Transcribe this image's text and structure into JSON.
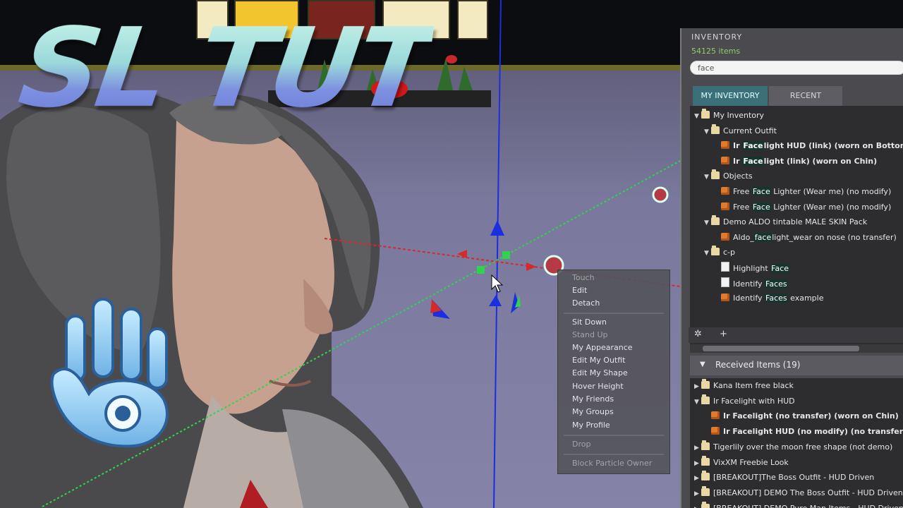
{
  "overlay": {
    "title": "SL TUT"
  },
  "context_menu": {
    "items": [
      {
        "label": "Touch",
        "dim": true
      },
      {
        "label": "Edit",
        "dim": false
      },
      {
        "label": "Detach",
        "dim": false
      },
      {
        "label": "Sit Down",
        "dim": false
      },
      {
        "label": "Stand Up",
        "dim": true
      },
      {
        "label": "My Appearance",
        "dim": false
      },
      {
        "label": "Edit My Outfit",
        "dim": false
      },
      {
        "label": "Edit My Shape",
        "dim": false
      },
      {
        "label": "Hover Height",
        "dim": false
      },
      {
        "label": "My Friends",
        "dim": false
      },
      {
        "label": "My Groups",
        "dim": false
      },
      {
        "label": "My Profile",
        "dim": false
      },
      {
        "label": "Drop",
        "dim": true
      },
      {
        "label": "Block Particle Owner",
        "dim": true
      }
    ]
  },
  "inventory": {
    "title": "INVENTORY",
    "count": "54125 items",
    "filter_value": "face",
    "tabs": [
      "MY INVENTORY",
      "RECENT"
    ],
    "active_tab": "MY INVENTORY",
    "tree": [
      {
        "indent": 0,
        "expanded": true,
        "icon": "folder",
        "parts": [
          {
            "t": "My Inventory"
          }
        ]
      },
      {
        "indent": 1,
        "expanded": true,
        "icon": "folder",
        "parts": [
          {
            "t": "Current Outfit"
          }
        ]
      },
      {
        "indent": 2,
        "icon": "object",
        "bold": true,
        "parts": [
          {
            "t": "Ir "
          },
          {
            "t": "Face",
            "hl": true
          },
          {
            "t": "light HUD (link) (worn on Bottom)"
          }
        ]
      },
      {
        "indent": 2,
        "icon": "object",
        "bold": true,
        "parts": [
          {
            "t": "Ir "
          },
          {
            "t": "Face",
            "hl": true
          },
          {
            "t": "light (link) (worn on Chin)"
          }
        ]
      },
      {
        "indent": 1,
        "expanded": true,
        "icon": "folder",
        "parts": [
          {
            "t": "Objects"
          }
        ]
      },
      {
        "indent": 2,
        "icon": "object",
        "parts": [
          {
            "t": "Free "
          },
          {
            "t": "Face",
            "hl": true
          },
          {
            "t": " Lighter (Wear me) (no modify)"
          }
        ]
      },
      {
        "indent": 2,
        "icon": "object",
        "parts": [
          {
            "t": "Free "
          },
          {
            "t": "Face",
            "hl": true
          },
          {
            "t": " Lighter (Wear me) (no modify)"
          }
        ]
      },
      {
        "indent": 1,
        "expanded": true,
        "icon": "folder",
        "parts": [
          {
            "t": "Demo ALDO tintable MALE SKIN Pack"
          }
        ]
      },
      {
        "indent": 2,
        "icon": "object",
        "parts": [
          {
            "t": "Aldo_"
          },
          {
            "t": "face",
            "hl": true
          },
          {
            "t": "light_wear on nose (no transfer)"
          }
        ]
      },
      {
        "indent": 1,
        "expanded": true,
        "icon": "folder",
        "parts": [
          {
            "t": "c-p"
          }
        ]
      },
      {
        "indent": 2,
        "icon": "note",
        "parts": [
          {
            "t": "Highlight "
          },
          {
            "t": "Face",
            "hl": true
          }
        ]
      },
      {
        "indent": 2,
        "icon": "note",
        "parts": [
          {
            "t": "Identify "
          },
          {
            "t": "Faces",
            "hl": true
          }
        ]
      },
      {
        "indent": 2,
        "icon": "object",
        "parts": [
          {
            "t": "Identify "
          },
          {
            "t": "Faces",
            "hl": true
          },
          {
            "t": " example"
          }
        ]
      }
    ],
    "received": {
      "title": "Received Items (19)",
      "items": [
        {
          "indent": 0,
          "expanded": false,
          "icon": "folder",
          "parts": [
            {
              "t": "Kana Item free black"
            }
          ]
        },
        {
          "indent": 0,
          "expanded": true,
          "icon": "folder",
          "parts": [
            {
              "t": "Ir Facelight with HUD"
            }
          ]
        },
        {
          "indent": 1,
          "icon": "object",
          "bold": true,
          "parts": [
            {
              "t": "Ir Facelight (no transfer) (worn on Chin)"
            }
          ]
        },
        {
          "indent": 1,
          "icon": "object",
          "bold": true,
          "parts": [
            {
              "t": "Ir Facelight HUD (no modify) (no transfer)"
            }
          ]
        },
        {
          "indent": 0,
          "expanded": false,
          "icon": "folder",
          "parts": [
            {
              "t": "Tigerlily over the moon free shape (not demo)"
            }
          ]
        },
        {
          "indent": 0,
          "expanded": false,
          "icon": "folder",
          "parts": [
            {
              "t": "VixXM Freebie Look"
            }
          ]
        },
        {
          "indent": 0,
          "expanded": false,
          "icon": "folder",
          "parts": [
            {
              "t": "[BREAKOUT]The Boss Outfit - HUD Driven"
            }
          ]
        },
        {
          "indent": 0,
          "expanded": false,
          "icon": "folder",
          "parts": [
            {
              "t": "[BREAKOUT] DEMO The Boss Outfit - HUD Driven"
            }
          ]
        },
        {
          "indent": 0,
          "expanded": false,
          "icon": "folder",
          "parts": [
            {
              "t": "[BREAKOUT] DEMO Pure Man Items - HUD Driven"
            }
          ]
        }
      ]
    }
  }
}
